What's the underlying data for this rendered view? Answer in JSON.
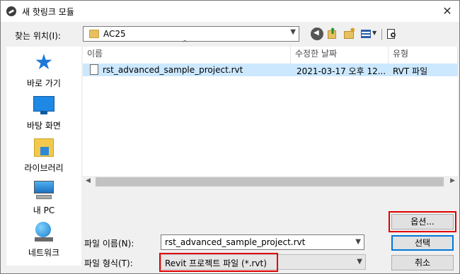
{
  "window": {
    "title": "새 핫링크 모듈",
    "close_label": "✕"
  },
  "toolbar": {
    "lookin_label": "찾는 위치(I):",
    "current_folder": "AC25",
    "icons": [
      "back-icon",
      "up-folder-icon",
      "new-folder-icon",
      "view-menu-icon",
      "preview-icon"
    ]
  },
  "places": [
    {
      "label": "바로 가기",
      "icon": "quick-access-star-icon"
    },
    {
      "label": "바탕 화면",
      "icon": "desktop-icon"
    },
    {
      "label": "라이브러리",
      "icon": "library-icon"
    },
    {
      "label": "내 PC",
      "icon": "this-pc-icon"
    },
    {
      "label": "네트워크",
      "icon": "network-icon"
    }
  ],
  "file_list": {
    "columns": [
      "이름",
      "수정한 날짜",
      "유형"
    ],
    "rows": [
      {
        "name": "rst_advanced_sample_project.rvt",
        "modified": "2021-03-17 오후 12...",
        "type": "RVT 파일"
      }
    ]
  },
  "form": {
    "filename_label": "파일 이름(N):",
    "filename_value": "rst_advanced_sample_project.rvt",
    "filetype_label": "파일 형식(T):",
    "filetype_value": "Revit 프로젝트 파일 (*.rvt)"
  },
  "buttons": {
    "options": "옵션...",
    "select": "선택",
    "cancel": "취소"
  },
  "colors": {
    "selection": "#cce8ff",
    "highlight": "#e00000",
    "accent": "#0078d7"
  }
}
